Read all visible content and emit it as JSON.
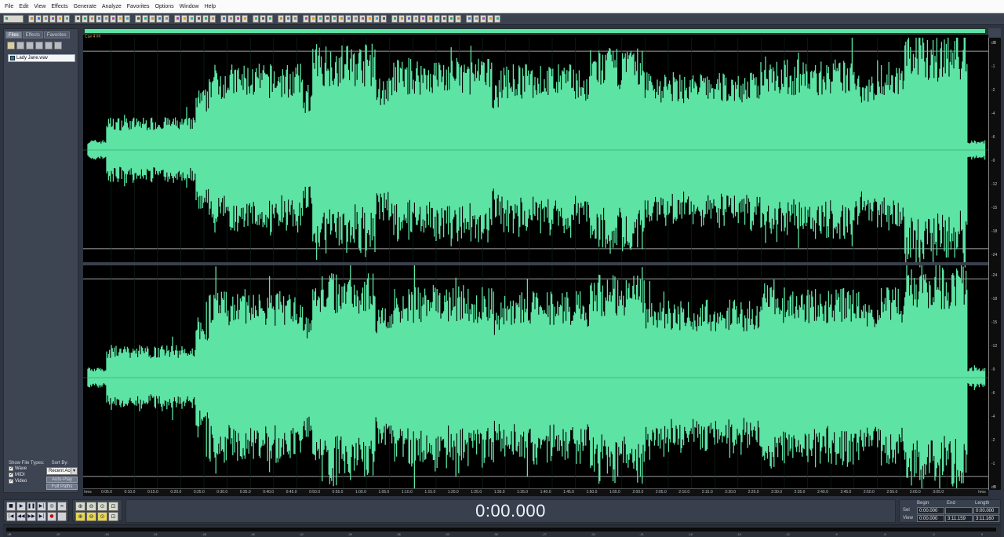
{
  "menu": [
    "File",
    "Edit",
    "View",
    "Effects",
    "Generate",
    "Analyze",
    "Favorites",
    "Options",
    "Window",
    "Help"
  ],
  "panel": {
    "tabs": [
      "Files",
      "Effects",
      "Favorites"
    ],
    "active_tab": "Files",
    "files": [
      "Lady Jane.wav"
    ],
    "show_file_types_label": "Show File Types:",
    "sort_by_label": "Sort By:",
    "file_types": [
      "Wave",
      "MIDI",
      "Video"
    ],
    "sort_value": "Recent Acc",
    "auto_play_label": "Auto-Play",
    "full_paths_label": "Full Paths"
  },
  "waveform": {
    "cue_label": "Cue 4 ##",
    "timeline_labels": [
      "hms",
      "0:05.0",
      "0:10.0",
      "0:15.0",
      "0:20.0",
      "0:25.0",
      "0:30.0",
      "0:35.0",
      "0:40.0",
      "0:45.0",
      "0:50.0",
      "0:55.0",
      "1:00.0",
      "1:05.0",
      "1:10.0",
      "1:15.0",
      "1:20.0",
      "1:25.0",
      "1:30.0",
      "1:35.0",
      "1:40.0",
      "1:45.0",
      "1:50.0",
      "1:55.0",
      "2:00.0",
      "2:05.0",
      "2:10.0",
      "2:15.0",
      "2:20.0",
      "2:25.0",
      "2:30.0",
      "2:35.0",
      "2:40.0",
      "2:45.0",
      "2:50.0",
      "2:55.0",
      "3:00.0",
      "3:05.0",
      "hms"
    ],
    "ruler_labels": [
      "dB",
      "-1",
      "-2",
      "-4",
      "-6",
      "-9",
      "-12",
      "-15",
      "-18",
      "-24",
      "-24",
      "-18",
      "-15",
      "-12",
      "-9",
      "-6",
      "-4",
      "-2",
      "-1",
      "dB"
    ],
    "wave_color": "#5de3a4"
  },
  "transport": {
    "buttons": [
      "stop",
      "play",
      "pause",
      "play-to-end",
      "loop",
      "record-placeholder",
      "go-start",
      "rewind",
      "fast-forward",
      "go-end",
      "record",
      "blank"
    ]
  },
  "time_display": "0:00.000",
  "selection_view": {
    "headers": [
      "Begin",
      "End",
      "Length"
    ],
    "rows": [
      {
        "label": "Sel",
        "values": [
          "0:00.000",
          "",
          "0:00.000"
        ]
      },
      {
        "label": "View",
        "values": [
          "0:00.000",
          "3:11.159",
          "3:11.160"
        ]
      }
    ]
  },
  "level_meter_labels": [
    "dB",
    "-57",
    "-54",
    "-51",
    "-48",
    "-45",
    "-42",
    "-39",
    "-36",
    "-33",
    "-30",
    "-27",
    "-24",
    "-21",
    "-18",
    "-15",
    "-12",
    "-9",
    "-6",
    "-3",
    "0"
  ]
}
